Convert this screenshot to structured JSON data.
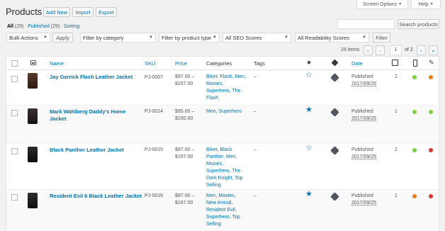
{
  "header": {
    "title": "Products",
    "add_new": "Add New",
    "import": "Import",
    "export": "Export",
    "screen_options": "Screen Options",
    "help": "Help"
  },
  "search": {
    "button": "Search products"
  },
  "views": {
    "all": "All",
    "all_count": "(29)",
    "published": "Published",
    "published_count": "(29)",
    "sorting": "Sorting",
    "sep": "|"
  },
  "filters": {
    "bulk_actions": "Bulk Actions",
    "apply": "Apply",
    "category": "Filter by category",
    "product_type": "Filter by product type",
    "seo": "All SEO Scores",
    "readability": "All Readability Scores",
    "filter": "Filter"
  },
  "pagination": {
    "items": "29 items",
    "first": "«",
    "prev": "‹",
    "current": "1",
    "of": "of 2",
    "next": "›",
    "last": "»"
  },
  "columns": {
    "name": "Name",
    "sku": "SKU",
    "price": "Price",
    "categories": "Categories",
    "tags": "Tags",
    "date": "Date"
  },
  "colors": {
    "link": "#0073aa",
    "green": "#7ad03a",
    "orange": "#ee7c1b",
    "red": "#dc3232"
  },
  "rows": [
    {
      "name": "Jay Garrick Flash Leather Jacket",
      "sku": "PJ-0007",
      "price": [
        "$97.00 –",
        "$157.00"
      ],
      "categories": [
        "Biker, Flash, Men,",
        "Movies,",
        "Superhero, The",
        "Flash"
      ],
      "tags": "–",
      "featured": false,
      "status": "Published",
      "date": "2017/09/26",
      "comments": "2",
      "seo": "green",
      "readability": "orange"
    },
    {
      "name": "Mark Wahlberg Daddy's Home",
      "name2": "Jacket",
      "sku": "PJ-0014",
      "price": [
        "$95.00 –",
        "$150.00"
      ],
      "categories": [
        "Men, Superhero"
      ],
      "tags": "–",
      "featured": true,
      "status": "Published",
      "date": "2017/09/25",
      "comments": "1",
      "seo": "green",
      "readability": "green"
    },
    {
      "name": "Black Panther Leather Jacket",
      "sku": "PJ-0015",
      "price": [
        "$97.00 –",
        "$157.00"
      ],
      "categories": [
        "Biker, Black",
        "Panther, Men,",
        "Movies,",
        "Superhero, The",
        "Dark Knight, Top",
        "Selling"
      ],
      "tags": "–",
      "featured": false,
      "status": "Published",
      "date": "2017/09/25",
      "comments": "2",
      "seo": "green",
      "readability": "red"
    },
    {
      "name": "Resident Evil 6 Black Leather Jacket",
      "sku": "PJ-0016",
      "price": [
        "$97.00 –",
        "$167.00"
      ],
      "categories": [
        "Men, Movies,",
        "New Arrival,",
        "Resident Evil,",
        "Superhero, Top",
        "Selling"
      ],
      "tags": "–",
      "featured": true,
      "status": "Published",
      "date": "2017/09/25",
      "comments": "1",
      "seo": "orange",
      "readability": "red"
    }
  ]
}
